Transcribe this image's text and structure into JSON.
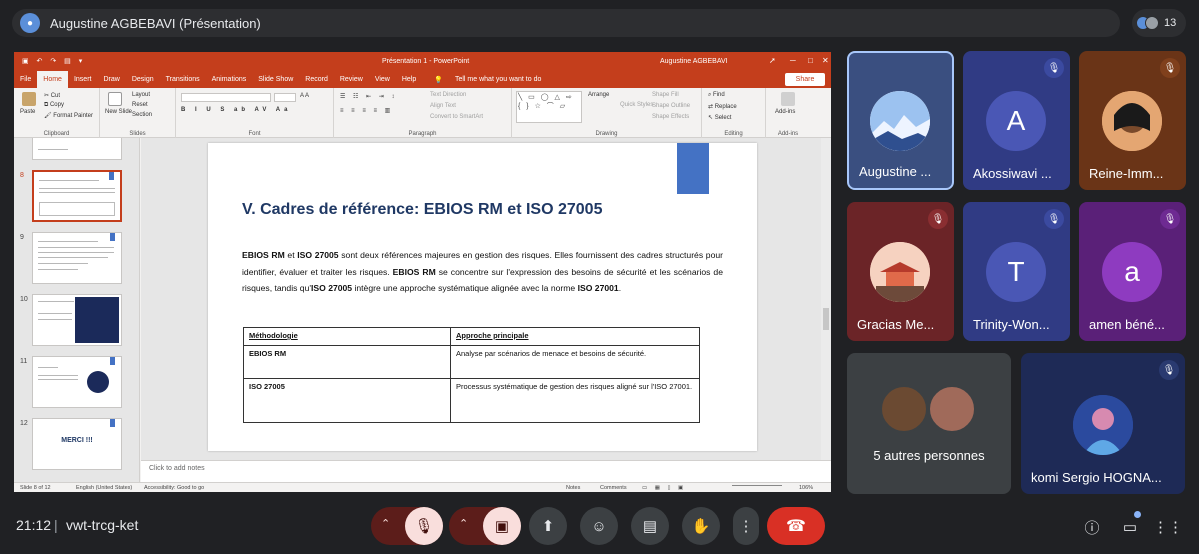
{
  "meeting": {
    "presenter_label": "Augustine AGBEBAVI (Présentation)",
    "participant_count": "13",
    "time": "21:12",
    "separator": "|",
    "code": "vwt-trcg-ket"
  },
  "powerpoint": {
    "document_title": "Présentation 1 - PowerPoint",
    "user_name": "Augustine AGBEBAVI",
    "menu": [
      "File",
      "Home",
      "Insert",
      "Draw",
      "Design",
      "Transitions",
      "Animations",
      "Slide Show",
      "Record",
      "Review",
      "View",
      "Help"
    ],
    "tell_me": "Tell me what you want to do",
    "share": "Share",
    "ribbon": {
      "paste": "Paste",
      "cut": "Cut",
      "copy": "Copy",
      "format_painter": "Format Painter",
      "clipboard": "Clipboard",
      "new_slide": "New Slide",
      "layout": "Layout",
      "reset": "Reset",
      "section": "Section",
      "slides": "Slides",
      "font": "Font",
      "text_direction": "Text Direction",
      "align_text": "Align Text",
      "convert_smartart": "Convert to SmartArt",
      "paragraph": "Paragraph",
      "arrange": "Arrange",
      "quick_styles": "Quick Styles",
      "shape_fill": "Shape Fill",
      "shape_outline": "Shape Outline",
      "shape_effects": "Shape Effects",
      "drawing": "Drawing",
      "find": "Find",
      "replace": "Replace",
      "select": "Select",
      "editing": "Editing",
      "addins": "Add-ins"
    },
    "thumbnails": [
      "8",
      "9",
      "10",
      "11",
      "12"
    ],
    "merci": "MERCI !!!",
    "slide": {
      "title": "V.  Cadres de référence: EBIOS RM et ISO 27005",
      "p1": "EBIOS RM",
      "p2": " et ",
      "p3": "ISO 27005",
      "p4": " sont deux références majeures en gestion des risques. Elles fournissent des cadres structurés pour identifier, évaluer et traiter les risques. ",
      "p5": "EBIOS RM",
      "p6": " se concentre sur l'expression des besoins de sécurité et les scénarios de risques, tandis qu'",
      "p7": "ISO 27005",
      "p8": " intègre une approche systématique alignée avec la norme ",
      "p9": "ISO 27001",
      "p10": ".",
      "table": {
        "headers": [
          "Méthodologie",
          "Approche principale"
        ],
        "rows": [
          [
            "EBIOS RM",
            "Analyse par scénarios de menace et besoins de sécurité."
          ],
          [
            "ISO 27005",
            "Processus systématique de gestion des risques aligné sur l'ISO 27001."
          ]
        ]
      }
    },
    "notes_placeholder": "Click to add notes",
    "status": {
      "slide": "Slide 8 of 12",
      "language": "English (United States)",
      "accessibility": "Accessibility: Good to go",
      "notes": "Notes",
      "comments": "Comments",
      "zoom": "106%"
    }
  },
  "participants": [
    {
      "name": "Augustine ...",
      "initial": ""
    },
    {
      "name": "Akossiwavi ...",
      "initial": "A"
    },
    {
      "name": "Reine-Imm...",
      "initial": ""
    },
    {
      "name": "Gracias Me...",
      "initial": ""
    },
    {
      "name": "Trinity-Won...",
      "initial": "T"
    },
    {
      "name": "amen béné...",
      "initial": "a"
    }
  ],
  "others": {
    "label": "5 autres personnes"
  },
  "komi": {
    "name": "komi Sergio HOGNA..."
  },
  "colors": {
    "powerpoint_red": "#c43e1c",
    "meet_bg": "#202124",
    "leave_red": "#d93025",
    "mic_off_bg": "#f9dedc"
  }
}
